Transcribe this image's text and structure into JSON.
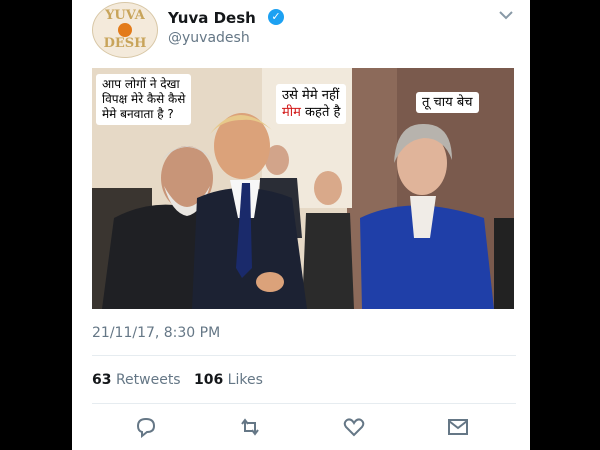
{
  "profile": {
    "display_name": "Yuva Desh",
    "handle": "@yuvadesh",
    "avatar_text_top": "YUVA",
    "avatar_text_bottom": "DESH",
    "verified_icon": "verified-badge-icon"
  },
  "photo": {
    "bubbles": [
      {
        "line1": "आप लोगों ने देखा",
        "line2": "विपक्ष मेरे कैसे कैसे",
        "line3": "मेमे बनवाता है ?"
      },
      {
        "line1": "उसे मेमे नहीं",
        "line2_highlight": "मीम",
        "line2_rest": " कहते है"
      },
      {
        "line1": "तू चाय बेच"
      }
    ]
  },
  "meta": {
    "timestamp": "21/11/17, 8:30 PM"
  },
  "stats": {
    "retweets_count": "63",
    "retweets_label": "Retweets",
    "likes_count": "106",
    "likes_label": "Likes"
  },
  "actions": [
    "reply-icon",
    "retweet-icon",
    "like-icon",
    "message-icon"
  ],
  "colors": {
    "accent": "#1da1f2",
    "text_secondary": "#657786",
    "highlight": "#d21a1a"
  }
}
